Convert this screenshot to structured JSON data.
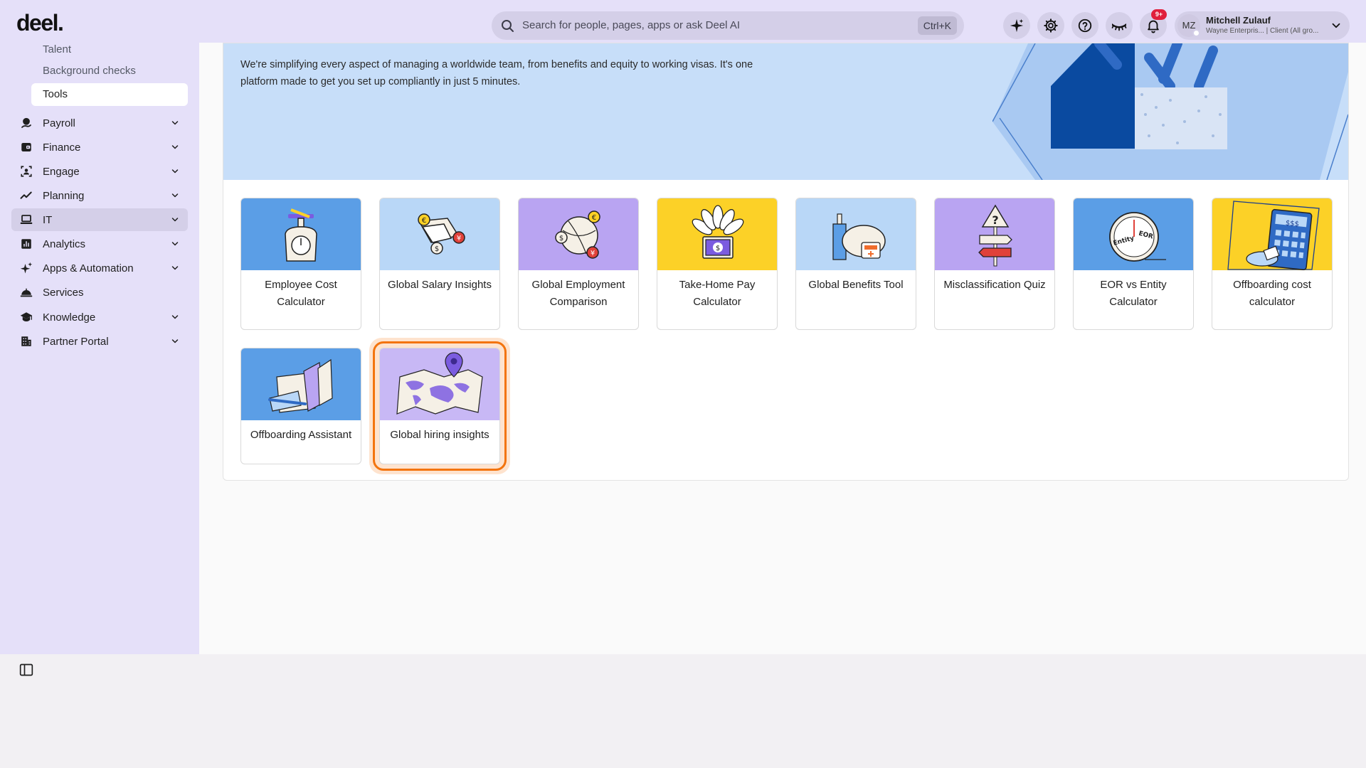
{
  "header": {
    "logo": "deel.",
    "search_placeholder": "Search for people, pages, apps or ask Deel AI",
    "search_shortcut": "Ctrl+K",
    "notifications_badge": "9+",
    "user": {
      "initials": "MZ",
      "name": "Mitchell Zulauf",
      "subtitle": "Wayne Enterpris... | Client (All gro..."
    }
  },
  "sidebar": {
    "subitems": [
      {
        "label": "Talent",
        "active": false
      },
      {
        "label": "Background checks",
        "active": false
      },
      {
        "label": "Tools",
        "active": true
      }
    ],
    "items": [
      {
        "label": "Payroll",
        "icon": "payroll-icon",
        "chevron": true
      },
      {
        "label": "Finance",
        "icon": "wallet-icon",
        "chevron": true
      },
      {
        "label": "Engage",
        "icon": "engage-icon",
        "chevron": true
      },
      {
        "label": "Planning",
        "icon": "trend-line-icon",
        "chevron": true
      },
      {
        "label": "IT",
        "icon": "laptop-icon",
        "chevron": true
      },
      {
        "label": "Analytics",
        "icon": "bar-chart-icon",
        "chevron": true
      },
      {
        "label": "Apps & Automation",
        "icon": "sparkle-icon",
        "chevron": true
      },
      {
        "label": "Services",
        "icon": "service-bell-icon",
        "chevron": false
      },
      {
        "label": "Knowledge",
        "icon": "graduation-cap-icon",
        "chevron": true
      },
      {
        "label": "Partner Portal",
        "icon": "building-icon",
        "chevron": true
      }
    ]
  },
  "banner": {
    "text": "We're simplifying every aspect of managing a worldwide team, from benefits and equity to working visas. It's one platform made to get you set up compliantly in just 5 minutes."
  },
  "tools": [
    {
      "label": "Employee Cost Calculator",
      "bg": "#5b9ee6",
      "art": "scale-icon"
    },
    {
      "label": "Global Salary Insights",
      "bg": "#b9d7f7",
      "art": "currency-envelope-icon"
    },
    {
      "label": "Global Employment Comparison",
      "bg": "#b9a4f2",
      "art": "globe-currency-icon"
    },
    {
      "label": "Take-Home Pay Calculator",
      "bg": "#fcd127",
      "art": "money-fan-icon"
    },
    {
      "label": "Global Benefits Tool",
      "bg": "#b9d7f7",
      "art": "piggy-bank-icon"
    },
    {
      "label": "Misclassification Quiz",
      "bg": "#b9a4f2",
      "art": "question-signpost-icon"
    },
    {
      "label": "EOR vs Entity Calculator",
      "bg": "#5b9ee6",
      "art": "eor-dial-icon"
    },
    {
      "label": "Offboarding cost calculator",
      "bg": "#fcd127",
      "art": "calculator-icon"
    },
    {
      "label": "Offboarding Assistant",
      "bg": "#5b9ee6",
      "art": "folder-icon"
    },
    {
      "label": "Global hiring insights",
      "bg": "#c8b8f5",
      "art": "world-map-pin-icon"
    }
  ],
  "labels": {
    "entity": "Entity",
    "eor": "EOR",
    "price": "$$$",
    "question": "?"
  }
}
